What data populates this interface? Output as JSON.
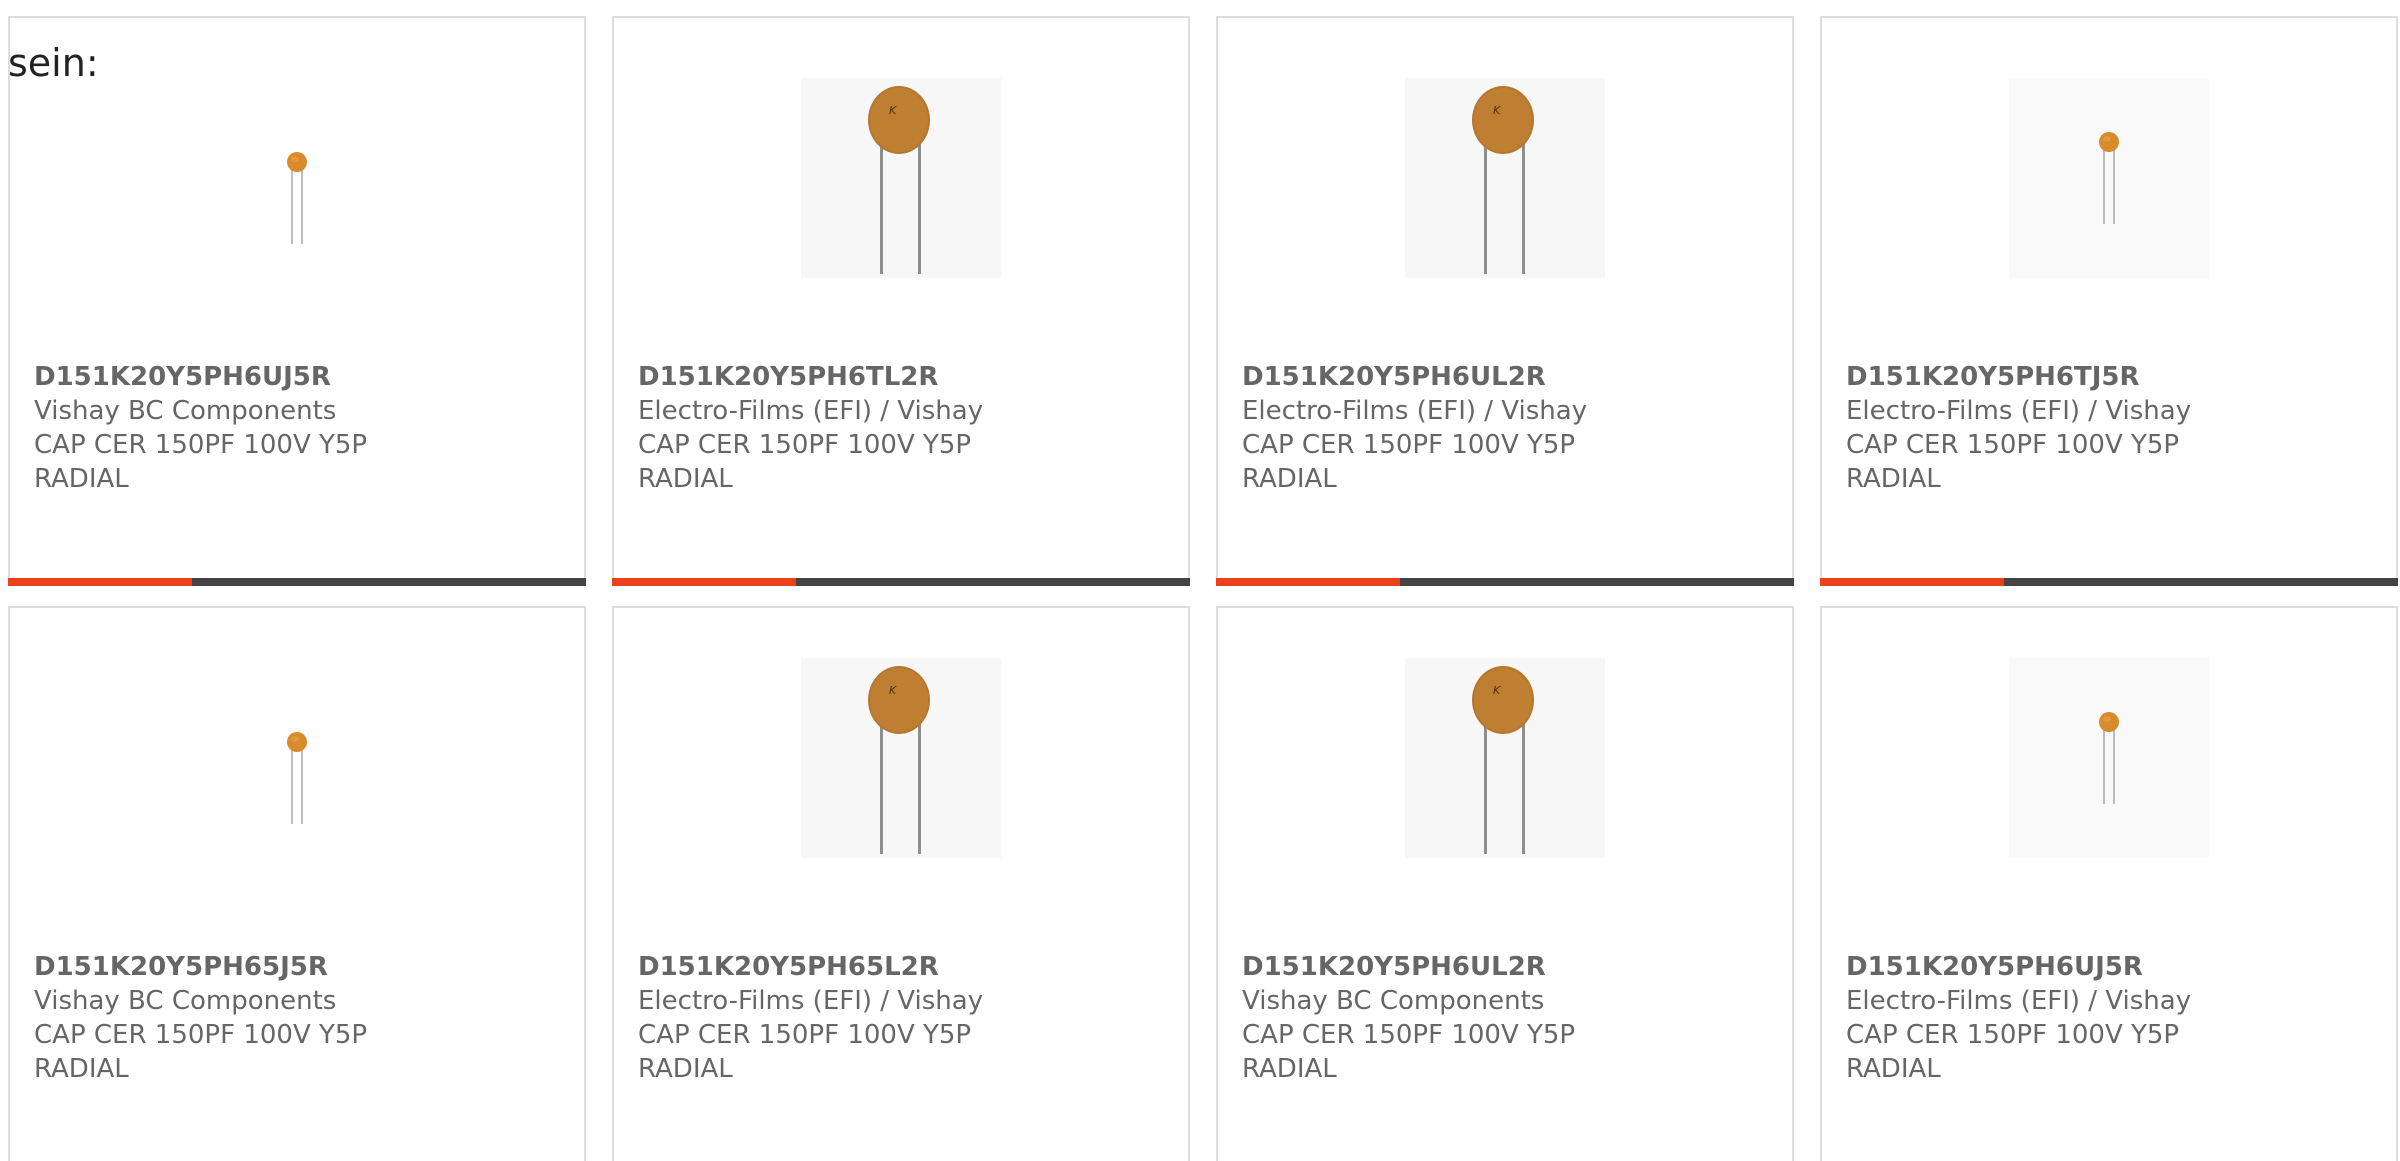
{
  "lead_text": "sein:",
  "colors": {
    "accent": "#e8411c",
    "bar_dark": "#444444",
    "card_border": "#dddddd",
    "text": "#666666"
  },
  "products": [
    {
      "part": "D151K20Y5PH6UJ5R",
      "maker": "Vishay BC Components",
      "desc1": "CAP CER 150PF 100V Y5P",
      "desc2": "RADIAL",
      "image": "small-capacitor-icon"
    },
    {
      "part": "D151K20Y5PH6TL2R",
      "maker": "Electro-Films (EFI) / Vishay",
      "desc1": "CAP CER 150PF 100V Y5P",
      "desc2": "RADIAL",
      "image": "large-capacitor-icon"
    },
    {
      "part": "D151K20Y5PH6UL2R",
      "maker": "Electro-Films (EFI) / Vishay",
      "desc1": "CAP CER 150PF 100V Y5P",
      "desc2": "RADIAL",
      "image": "large-capacitor-icon"
    },
    {
      "part": "D151K20Y5PH6TJ5R",
      "maker": "Electro-Films (EFI) / Vishay",
      "desc1": "CAP CER 150PF 100V Y5P",
      "desc2": "RADIAL",
      "image": "small-capacitor-icon"
    },
    {
      "part": "D151K20Y5PH65J5R",
      "maker": "Vishay BC Components",
      "desc1": "CAP CER 150PF 100V Y5P",
      "desc2": "RADIAL",
      "image": "small-capacitor-icon"
    },
    {
      "part": "D151K20Y5PH65L2R",
      "maker": "Electro-Films (EFI) / Vishay",
      "desc1": "CAP CER 150PF 100V Y5P",
      "desc2": "RADIAL",
      "image": "large-capacitor-icon"
    },
    {
      "part": "D151K20Y5PH6UL2R",
      "maker": "Vishay BC Components",
      "desc1": "CAP CER 150PF 100V Y5P",
      "desc2": "RADIAL",
      "image": "large-capacitor-icon"
    },
    {
      "part": "D151K20Y5PH6UJ5R",
      "maker": "Electro-Films (EFI) / Vishay",
      "desc1": "CAP CER 150PF 100V Y5P",
      "desc2": "RADIAL",
      "image": "small-capacitor-icon"
    }
  ]
}
